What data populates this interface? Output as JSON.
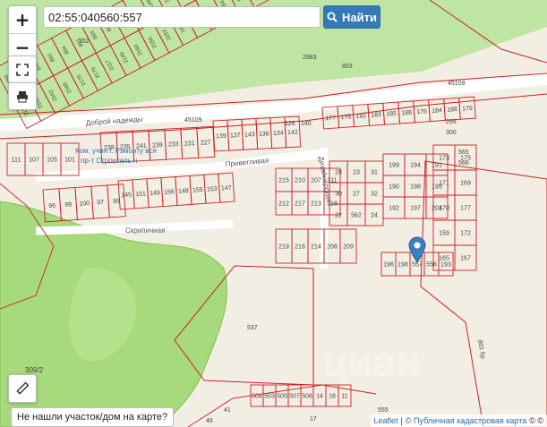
{
  "search": {
    "value": "02:55:040560:557",
    "button_label": "Найти",
    "button_icon": "search-icon"
  },
  "controls": {
    "zoom_in": "+",
    "zoom_out": "−",
    "fullscreen_icon": "expand-icon",
    "print_icon": "printer-icon",
    "measure_icon": "ruler-icon"
  },
  "not_found_label": "Не нашли участок/дом на карте?",
  "attribution": {
    "leaflet": "Leaflet",
    "separator": "|",
    "source": "© Публичная кадастровая карта",
    "trailing": "© ©"
  },
  "map": {
    "marker_color": "#3a7fc1",
    "parcel_color": "#cc2222",
    "forest_color": "#8fd36a",
    "street_labels": [
      {
        "id": "dobroy",
        "text": "Доброй надежды"
      },
      {
        "id": "privetlivaya",
        "text": "Приветливая"
      },
      {
        "id": "skripichnaya",
        "text": "Скрипичная"
      },
      {
        "id": "dizainerskaya",
        "text": "Дизайнерская"
      }
    ],
    "tech_labels": [
      {
        "id": "t45109",
        "text": "45109"
      },
      {
        "id": "t45108",
        "text": "45108"
      },
      {
        "id": "t352",
        "text": "352"
      },
      {
        "id": "t537",
        "text": "537"
      },
      {
        "id": "t803",
        "text": "803"
      },
      {
        "id": "t2983",
        "text": "2983"
      },
      {
        "id": "t309",
        "text": "309/2"
      },
      {
        "id": "t8015",
        "text": "801 5р"
      },
      {
        "id": "t140",
        "text": "140"
      },
      {
        "id": "t126",
        "text": "126"
      },
      {
        "id": "t299",
        "text": "299"
      },
      {
        "id": "t300",
        "text": "300"
      },
      {
        "id": "t565",
        "text": "565"
      },
      {
        "id": "t566",
        "text": "566"
      },
      {
        "id": "t41",
        "text": "41"
      },
      {
        "id": "t46",
        "text": "46"
      },
      {
        "id": "t17",
        "text": "17"
      },
      {
        "id": "t555",
        "text": "555"
      }
    ],
    "blue_label": {
      "line1": "Ком. учия г. Рэмонту вся",
      "line2": "пр-т Строитель н"
    },
    "parcel_rows": [
      {
        "id": "r1",
        "labels": [
          "111",
          "107",
          "105",
          "101"
        ]
      },
      {
        "id": "r2",
        "labels": [
          "238",
          "235",
          "241",
          "239",
          "233",
          "231",
          "227"
        ]
      },
      {
        "id": "r3",
        "labels": [
          "139",
          "137",
          "143",
          "136",
          "134",
          "142"
        ]
      },
      {
        "id": "r4",
        "labels": [
          "96",
          "98",
          "100",
          "97",
          "99"
        ]
      },
      {
        "id": "r5",
        "labels": [
          "145",
          "151",
          "149",
          "156",
          "148",
          "155",
          "153",
          "147"
        ]
      },
      {
        "id": "r6",
        "labels": [
          "215",
          "210",
          "207",
          "211",
          "212",
          "217",
          "213",
          "218"
        ]
      },
      {
        "id": "r7",
        "labels": [
          "219",
          "216",
          "214",
          "208",
          "209"
        ]
      },
      {
        "id": "r8",
        "labels": [
          "28",
          "23",
          "31",
          "30",
          "27",
          "32",
          "22",
          "562",
          "24"
        ]
      },
      {
        "id": "r9",
        "labels": [
          "199",
          "194",
          "191",
          "190",
          "198",
          "195",
          "192",
          "197",
          "204"
        ]
      },
      {
        "id": "r10",
        "labels": [
          "173",
          "175",
          "171",
          "169",
          "170",
          "177",
          "159",
          "172",
          "165",
          "167"
        ]
      },
      {
        "id": "r11",
        "labels": [
          "177",
          "178",
          "182",
          "183",
          "185",
          "188",
          "176",
          "184",
          "188",
          "179"
        ]
      },
      {
        "id": "r12",
        "labels": [
          "196",
          "198",
          "557",
          "556",
          "193"
        ]
      },
      {
        "id": "r13",
        "labels": [
          "504",
          "503",
          "505",
          "507",
          "506",
          "14",
          "18",
          "11"
        ]
      }
    ],
    "top_block_labels": [
      "3450",
      "3445",
      "3440",
      "892",
      "894",
      "891",
      "883",
      "889",
      "885",
      "2147",
      "2149",
      "2152",
      "2154",
      "3148",
      "3154",
      "2153",
      "2145",
      "2151",
      "2159",
      "2162",
      "2165",
      "2170",
      "2176",
      "2117",
      "2140",
      "2160",
      "2150",
      "3152",
      "3455",
      "4451",
      "3460",
      "864",
      "870",
      "872"
    ]
  }
}
